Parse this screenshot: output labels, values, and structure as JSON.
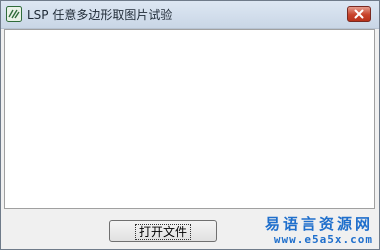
{
  "window": {
    "title": "LSP 任意多边形取图片试验",
    "icon": "app-icon",
    "close_icon": "close-icon"
  },
  "main": {
    "open_file_button_label": "打开文件"
  },
  "watermark": {
    "site_name": "易语言资源网",
    "url": "www.e5a5x.com"
  },
  "colors": {
    "titlebar_top": "#dde7f3",
    "titlebar_bottom": "#c9d6e6",
    "close_button": "#c8432b",
    "watermark": "#1f6fcc",
    "window_background": "#f0f0f0"
  }
}
